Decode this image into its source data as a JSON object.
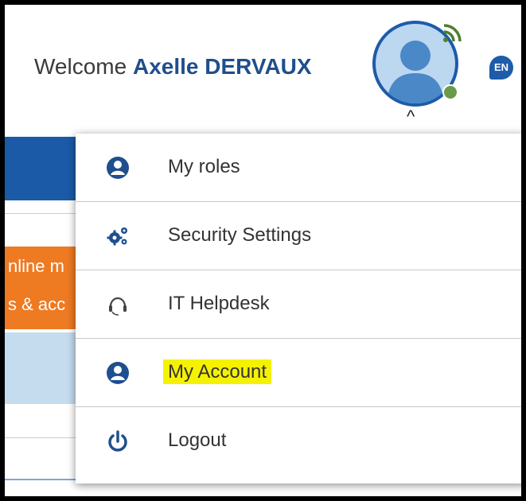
{
  "header": {
    "welcome_prefix": "Welcome",
    "user_name": "Axelle DERVAUX",
    "language": "EN",
    "avatar_icon": "user-avatar-icon",
    "presence_status_color": "#6a9a4a",
    "caret": "^"
  },
  "background": {
    "orange_line1": "nline m",
    "orange_line2": "s & acc"
  },
  "menu": {
    "items": [
      {
        "label": "My roles",
        "icon": "user-circle-icon"
      },
      {
        "label": "Security Settings",
        "icon": "gears-icon"
      },
      {
        "label": "IT Helpdesk",
        "icon": "headset-icon"
      },
      {
        "label": "My Account",
        "icon": "user-circle-icon",
        "highlighted": true
      },
      {
        "label": "Logout",
        "icon": "power-icon"
      }
    ]
  },
  "colors": {
    "brand_blue": "#1e5ba8",
    "name_color": "#1f4e8c",
    "orange": "#ee7a22",
    "highlight": "#f5f200"
  }
}
